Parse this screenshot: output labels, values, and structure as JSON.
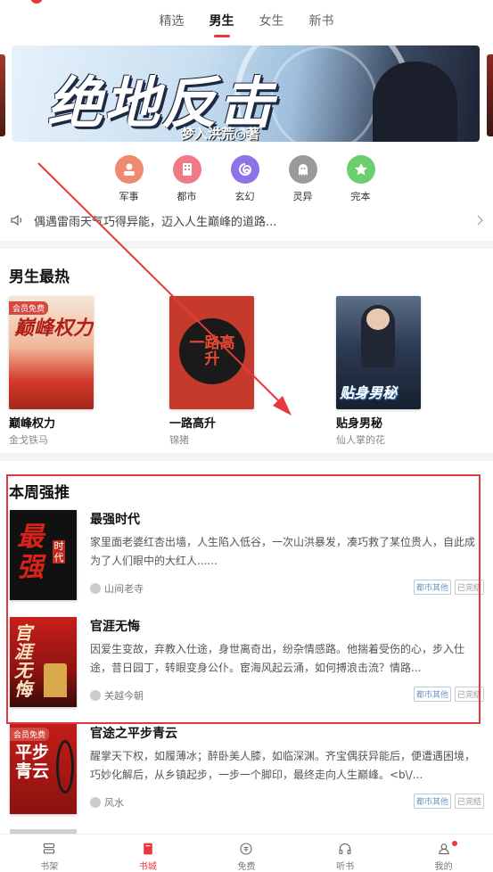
{
  "tabs": [
    {
      "label": "精选",
      "active": false
    },
    {
      "label": "男生",
      "active": true
    },
    {
      "label": "女生",
      "active": false
    },
    {
      "label": "新书",
      "active": false
    }
  ],
  "banner": {
    "title": "绝地反击",
    "subtitle": "梦入洪荒◎著"
  },
  "categories": [
    {
      "label": "军事",
      "icon": "soldier-icon",
      "color": "#f08a6e"
    },
    {
      "label": "都市",
      "icon": "building-icon",
      "color": "#f07a86"
    },
    {
      "label": "玄幻",
      "icon": "swirl-icon",
      "color": "#8c73e8"
    },
    {
      "label": "灵异",
      "icon": "ghost-icon",
      "color": "#9a9a9a"
    },
    {
      "label": "完本",
      "icon": "star-icon",
      "color": "#6ccf6e"
    }
  ],
  "notice": {
    "text": "偶遇雷雨天气巧得异能，迈入人生巅峰的道路..."
  },
  "hot": {
    "title": "男生最热",
    "books": [
      {
        "title": "巅峰权力",
        "author": "金戈铁马",
        "badge": "会员免费",
        "cover_text": "巅峰权力"
      },
      {
        "title": "一路高升",
        "author": "锦猪",
        "cover_text": "一路高升"
      },
      {
        "title": "贴身男秘",
        "author": "仙人掌的花",
        "cover_text": "贴身男秘"
      }
    ]
  },
  "weekly": {
    "title": "本周强推",
    "books": [
      {
        "title": "最强时代",
        "desc": "家里面老婆红杏出墙，人生陷入低谷，一次山洪暴发，凑巧救了某位贵人，自此成为了人们眼中的大红人......",
        "author": "山间老寺",
        "tags": [
          "都市其他",
          "已完结"
        ],
        "cover_text": "最强",
        "cover_side": "时代"
      },
      {
        "title": "官涯无悔",
        "desc": "因爱生变故，弃教入仕途，身世离奇出，纷杂情感路。他揣着受伤的心，步入仕途，昔日园丁，转眼变身公仆。宦海风起云涌，如何搏浪击流？情路...",
        "author": "关越今朝",
        "tags": [
          "都市其他",
          "已完结"
        ],
        "cover_text": "官涯无悔"
      },
      {
        "title": "官途之平步青云",
        "desc": "醒掌天下权，如履薄冰；醉卧美人膝，如临深渊。齐宝偶获异能后，便遭遇困境，巧妙化解后，从乡镇起步，一步一个脚印，最终走向人生巅峰。<b\\/...",
        "author": "风水",
        "tags": [
          "都市其他",
          "已完结"
        ],
        "badge": "会员免费",
        "cover_text": "平步青云"
      }
    ]
  },
  "bottom_nav": [
    {
      "label": "书架",
      "icon": "bookshelf-icon",
      "active": false
    },
    {
      "label": "书城",
      "icon": "bookstore-icon",
      "active": true
    },
    {
      "label": "免费",
      "icon": "free-icon",
      "active": false
    },
    {
      "label": "听书",
      "icon": "headphones-icon",
      "active": false
    },
    {
      "label": "我的",
      "icon": "profile-icon",
      "active": false
    }
  ]
}
